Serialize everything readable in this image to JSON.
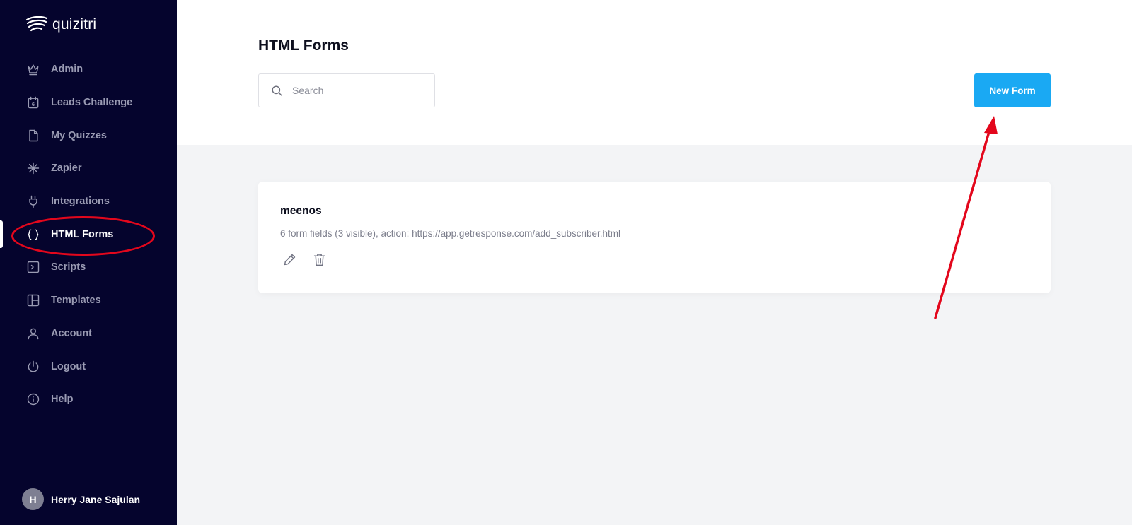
{
  "brand": {
    "name": "quizitri"
  },
  "sidebar": {
    "items": [
      {
        "label": "Admin",
        "icon": "crown-icon"
      },
      {
        "label": "Leads Challenge",
        "icon": "calendar-icon"
      },
      {
        "label": "My Quizzes",
        "icon": "file-icon"
      },
      {
        "label": "Zapier",
        "icon": "asterisk-icon"
      },
      {
        "label": "Integrations",
        "icon": "plug-icon"
      },
      {
        "label": "HTML Forms",
        "icon": "braces-icon",
        "active": true
      },
      {
        "label": "Scripts",
        "icon": "terminal-icon"
      },
      {
        "label": "Templates",
        "icon": "layout-icon"
      },
      {
        "label": "Account",
        "icon": "user-icon"
      },
      {
        "label": "Logout",
        "icon": "power-icon"
      },
      {
        "label": "Help",
        "icon": "info-icon"
      }
    ],
    "calendar_day": "6"
  },
  "user": {
    "initial": "H",
    "name": "Herry Jane Sajulan"
  },
  "main": {
    "title": "HTML Forms",
    "search_placeholder": "Search",
    "new_button": "New Form"
  },
  "forms": [
    {
      "name": "meenos",
      "description": "6 form fields (3 visible), action: https://app.getresponse.com/add_subscriber.html"
    }
  ],
  "colors": {
    "sidebar_bg": "#05042d",
    "accent": "#1aa9f3",
    "annotation": "#e3071c"
  }
}
